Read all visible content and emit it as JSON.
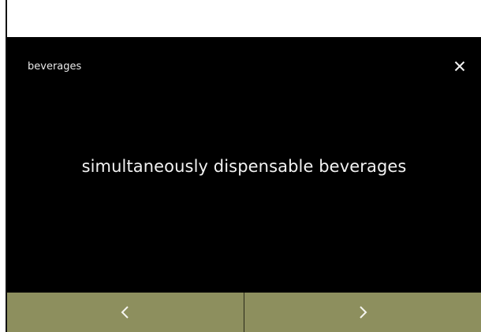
{
  "header": {
    "title": "beverages"
  },
  "main": {
    "text": "simultaneously dispensable beverages"
  },
  "icons": {
    "close": "close-icon",
    "previous": "chevron-left-icon",
    "next": "chevron-right-icon"
  },
  "colors": {
    "background": "#000000",
    "footer": "#8d8f5e",
    "text": "#f2f2f2"
  }
}
